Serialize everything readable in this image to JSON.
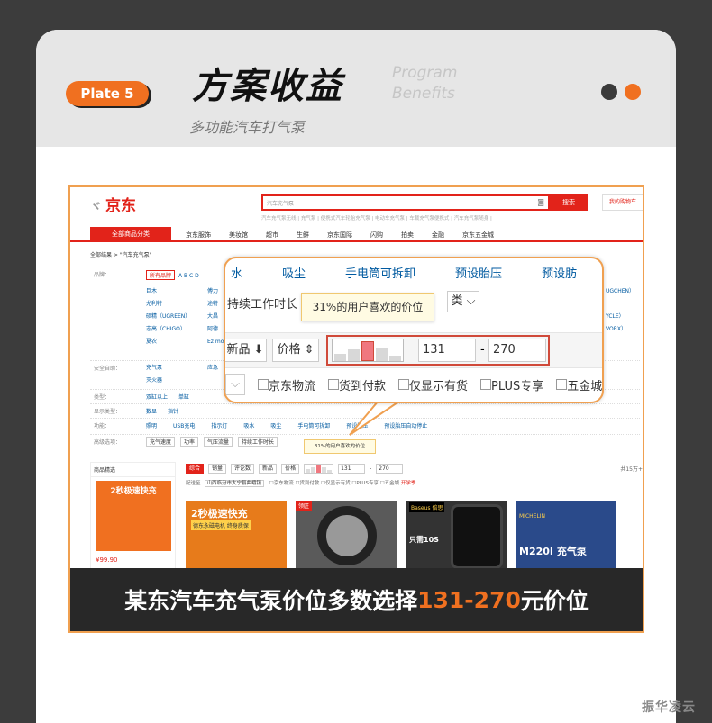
{
  "header": {
    "plate": "Plate 5",
    "title": "方案收益",
    "title_en_1": "Program",
    "title_en_2": "Benefits",
    "subtitle": "多功能汽车打气泵"
  },
  "jd": {
    "logo": "京东",
    "search_placeholder": "汽车充气泵",
    "search_button": "搜索",
    "cart": "我的购物车",
    "hot": "汽车充气泵无线 | 充气泵 | 便携式汽车轮胎充气泵 | 电动车充气泵 | 车载充气泵便携式 | 汽车充气泵随身 |",
    "nav_all": "全部商品分类",
    "nav": [
      "京东服饰",
      "美妆馆",
      "超市",
      "生鲜",
      "京东国际",
      "闪购",
      "拍卖",
      "金融",
      "京东五金城"
    ],
    "crumb": "全部结果 > \"汽车充气泵\"",
    "brand_label": "品牌：",
    "brand_all": "所有品牌",
    "brand_letters": "A  B  C  D",
    "brands_a": [
      "巨木",
      "尤利特",
      "硕精（UGREEN）",
      "志高（CHIGO）",
      "夏农"
    ],
    "brands_b": [
      "傅力",
      "途特",
      "大昌",
      "阿德",
      "Ez moe"
    ],
    "security_label": "安全自助：",
    "security_vals": [
      "充气泵",
      "灭火器"
    ],
    "security_extra": "应急",
    "type_label": "类型：",
    "type_vals": [
      "双缸以上",
      "单缸"
    ],
    "display_label": "显示类型：",
    "display_vals": [
      "数显",
      "指针"
    ],
    "func_label": "功能：",
    "func_vals": [
      "照明",
      "USB充电",
      "指示灯",
      "吸水",
      "吸尘",
      "手电筒可拆卸",
      "预设胎压",
      "预设胎压自动停止"
    ],
    "adv_label": "高级选项：",
    "adv_vals": [
      "充气速度",
      "功率",
      "气压流量",
      "持续工作时长"
    ],
    "right_brands": [
      "UGCHEN）",
      "YCLE）",
      "VORX）"
    ],
    "mini_sort": [
      "综合",
      "销量",
      "评论数",
      "新品",
      "价格"
    ],
    "mini_low": "131",
    "mini_high": "270",
    "mini_pages": "共15万+",
    "ship_label": "配送至",
    "ship_addr": "山西临汾市大宁县曲峨镇",
    "ship_opts": [
      "京东物流",
      "货到付款",
      "仅显示有货",
      "PLUS专享",
      "五金城"
    ],
    "ship_vip": "开学季",
    "side_title": "商品精选",
    "side_prod": "2秒极速快充",
    "side_price": "¥99.90",
    "p1_title": "2秒极速快充",
    "p1_sub": "德东永磁电机 终身质保",
    "p2_tag": "领匠",
    "p3_logo": "Baseus 倍思",
    "p3_text": "只需10S",
    "p4_top": "MICHELIN",
    "p4_model": "M220I 充气泵"
  },
  "mag": {
    "row1": [
      "水",
      "吸尘",
      "手电筒可拆卸",
      "预设胎压",
      "预设肪"
    ],
    "row2": "持续工作时长",
    "row2_sel": "类",
    "new": "新品",
    "new_arrow": "⬇",
    "price": "价格",
    "price_arrow": "⇕",
    "low": "131",
    "high": "270",
    "dash": "-",
    "row4": [
      "京东物流",
      "货到付款",
      "仅显示有货",
      "PLUS专享",
      "五金城"
    ]
  },
  "tip": "31%的用户喜欢的价位",
  "tip_small": "31%的用户喜欢的价位",
  "price_bars": [
    0.35,
    0.55,
    0.9,
    0.6,
    0.25
  ],
  "bottom": {
    "pre": "某东汽车充气泵价位多数选择",
    "hl": "131-270",
    "post": "元价位"
  },
  "watermark": "振华凌云"
}
